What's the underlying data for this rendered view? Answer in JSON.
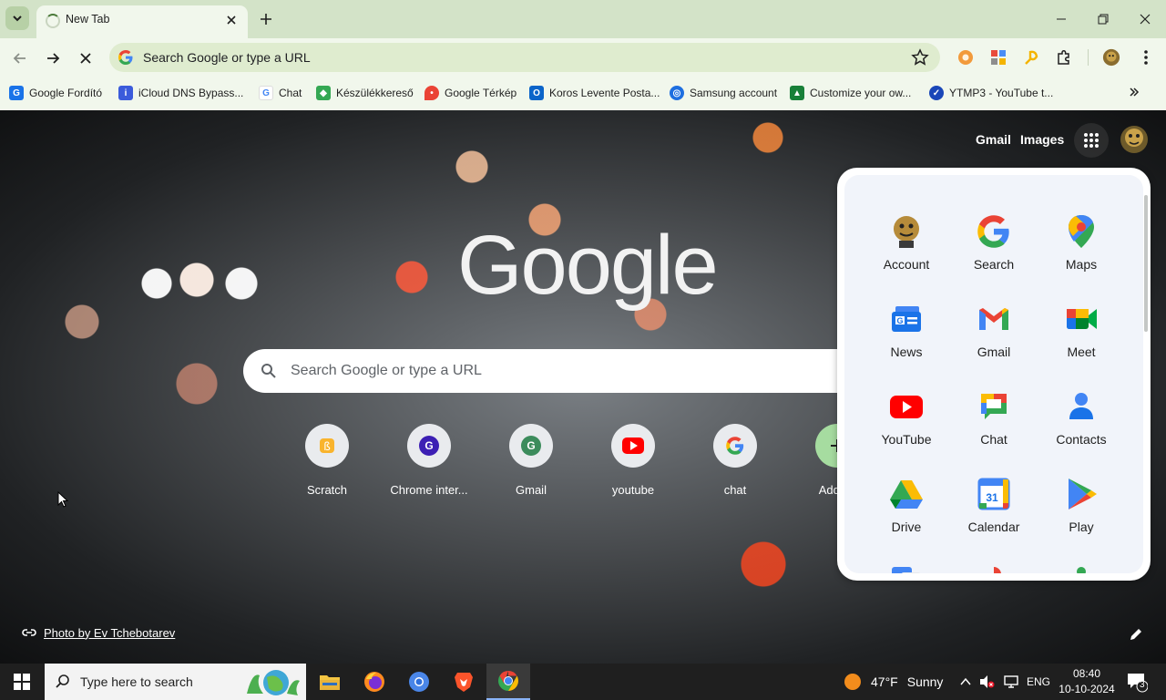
{
  "browser": {
    "tab_title": "New Tab",
    "omnibox_placeholder": "Search Google or type a URL"
  },
  "bookmarks": [
    {
      "label": "Google Fordító",
      "icon": "google-translate-icon",
      "color": "#1a73e8"
    },
    {
      "label": "iCloud DNS Bypass...",
      "icon": "icloud-dns-icon",
      "color": "#3b5bdb"
    },
    {
      "label": "Chat",
      "icon": "google-g-icon",
      "color": "#4285f4"
    },
    {
      "label": "Készülékkereső",
      "icon": "find-device-icon",
      "color": "#34a853"
    },
    {
      "label": "Google Térkép",
      "icon": "maps-pin-icon",
      "color": "#ea4335"
    },
    {
      "label": "Koros Levente Posta...",
      "icon": "outlook-icon",
      "color": "#0a64c9"
    },
    {
      "label": "Samsung account",
      "icon": "samsung-account-icon",
      "color": "#1e6fe0"
    },
    {
      "label": "Customize your ow...",
      "icon": "customize-icon",
      "color": "#188038"
    },
    {
      "label": "YTMP3 - YouTube t...",
      "icon": "ytmp3-icon",
      "color": "#1a47b8"
    }
  ],
  "ntp": {
    "gmail": "Gmail",
    "images": "Images",
    "logo": "Google",
    "search_placeholder": "Search Google or type a URL",
    "photo_credit": "Photo by Ev Tchebotarev",
    "shortcuts": [
      {
        "label": "Scratch",
        "icon": "scratch-icon",
        "color": "#f9b42d"
      },
      {
        "label": "Chrome inter...",
        "icon": "chrome-internals-icon",
        "color": "#3c1fb4"
      },
      {
        "label": "Gmail",
        "icon": "gmail-shortcut-icon",
        "color": "#3c8c5c"
      },
      {
        "label": "youtube",
        "icon": "youtube-icon",
        "color": "#ff0000"
      },
      {
        "label": "chat",
        "icon": "google-g-icon",
        "color": "#4285f4"
      },
      {
        "label": "Add sh",
        "icon": "add-shortcut-icon",
        "color": "#7cc97c"
      }
    ]
  },
  "apps_panel": {
    "apps": [
      {
        "label": "Account",
        "icon": "account-avatar-icon"
      },
      {
        "label": "Search",
        "icon": "google-search-icon"
      },
      {
        "label": "Maps",
        "icon": "maps-icon"
      },
      {
        "label": "News",
        "icon": "news-icon"
      },
      {
        "label": "Gmail",
        "icon": "gmail-icon"
      },
      {
        "label": "Meet",
        "icon": "meet-icon"
      },
      {
        "label": "YouTube",
        "icon": "youtube-icon"
      },
      {
        "label": "Chat",
        "icon": "chat-icon"
      },
      {
        "label": "Contacts",
        "icon": "contacts-icon"
      },
      {
        "label": "Drive",
        "icon": "drive-icon"
      },
      {
        "label": "Calendar",
        "icon": "calendar-icon"
      },
      {
        "label": "Play",
        "icon": "play-icon"
      }
    ],
    "calendar_day": "31"
  },
  "taskbar": {
    "search_placeholder": "Type here to search",
    "weather_temp": "47°F",
    "weather_text": "Sunny",
    "language": "ENG",
    "time": "08:40",
    "date": "10-10-2024",
    "notification_count": "3"
  },
  "colors": {
    "tab_strip": "#d3e3c8",
    "toolbar": "#f1f7ec",
    "omnibox": "#dfeccf",
    "taskbar": "#1f1f1f"
  }
}
